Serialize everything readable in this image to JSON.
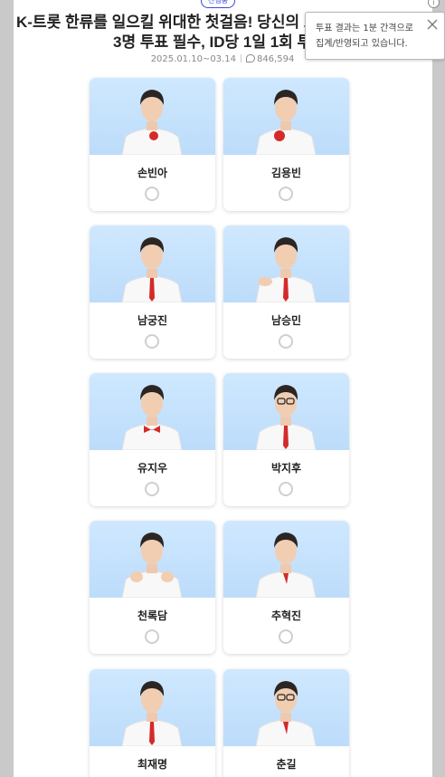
{
  "header": {
    "status_badge": "진행중",
    "info_icon": "i",
    "title_line1": "K-트롯 한류를 일으킬 위대한 첫걸음! 당신의 트롯 스타",
    "title_line2": "3명 투표 필수, ID당 1일 1회 투표 가능",
    "period": "2025.01.10~03.14",
    "comment_count": "846,594"
  },
  "tooltip": {
    "line1": "투표 결과는 1분 간격으로",
    "line2": "집계/반영되고 있습니다."
  },
  "candidates": [
    {
      "name": "손빈아",
      "accent": "#d42a2a",
      "selected": false
    },
    {
      "name": "김용빈",
      "accent": "#d42a2a",
      "selected": false
    },
    {
      "name": "남궁진",
      "accent": "#d42a2a",
      "selected": false
    },
    {
      "name": "남승민",
      "accent": "#d42a2a",
      "selected": false
    },
    {
      "name": "유지우",
      "accent": "#d42a2a",
      "selected": false
    },
    {
      "name": "박지후",
      "accent": "#d42a2a",
      "selected": false
    },
    {
      "name": "천록담",
      "accent": "#d42a2a",
      "selected": false
    },
    {
      "name": "추혁진",
      "accent": "#d42a2a",
      "selected": false
    },
    {
      "name": "최재명",
      "accent": "#d42a2a",
      "selected": false
    },
    {
      "name": "춘길",
      "accent": "#d42a2a",
      "selected": false
    }
  ],
  "colors": {
    "brand_blue": "#3b49d6",
    "photo_background": "#c4e2fc",
    "radio_border": "#cfcfcf"
  }
}
